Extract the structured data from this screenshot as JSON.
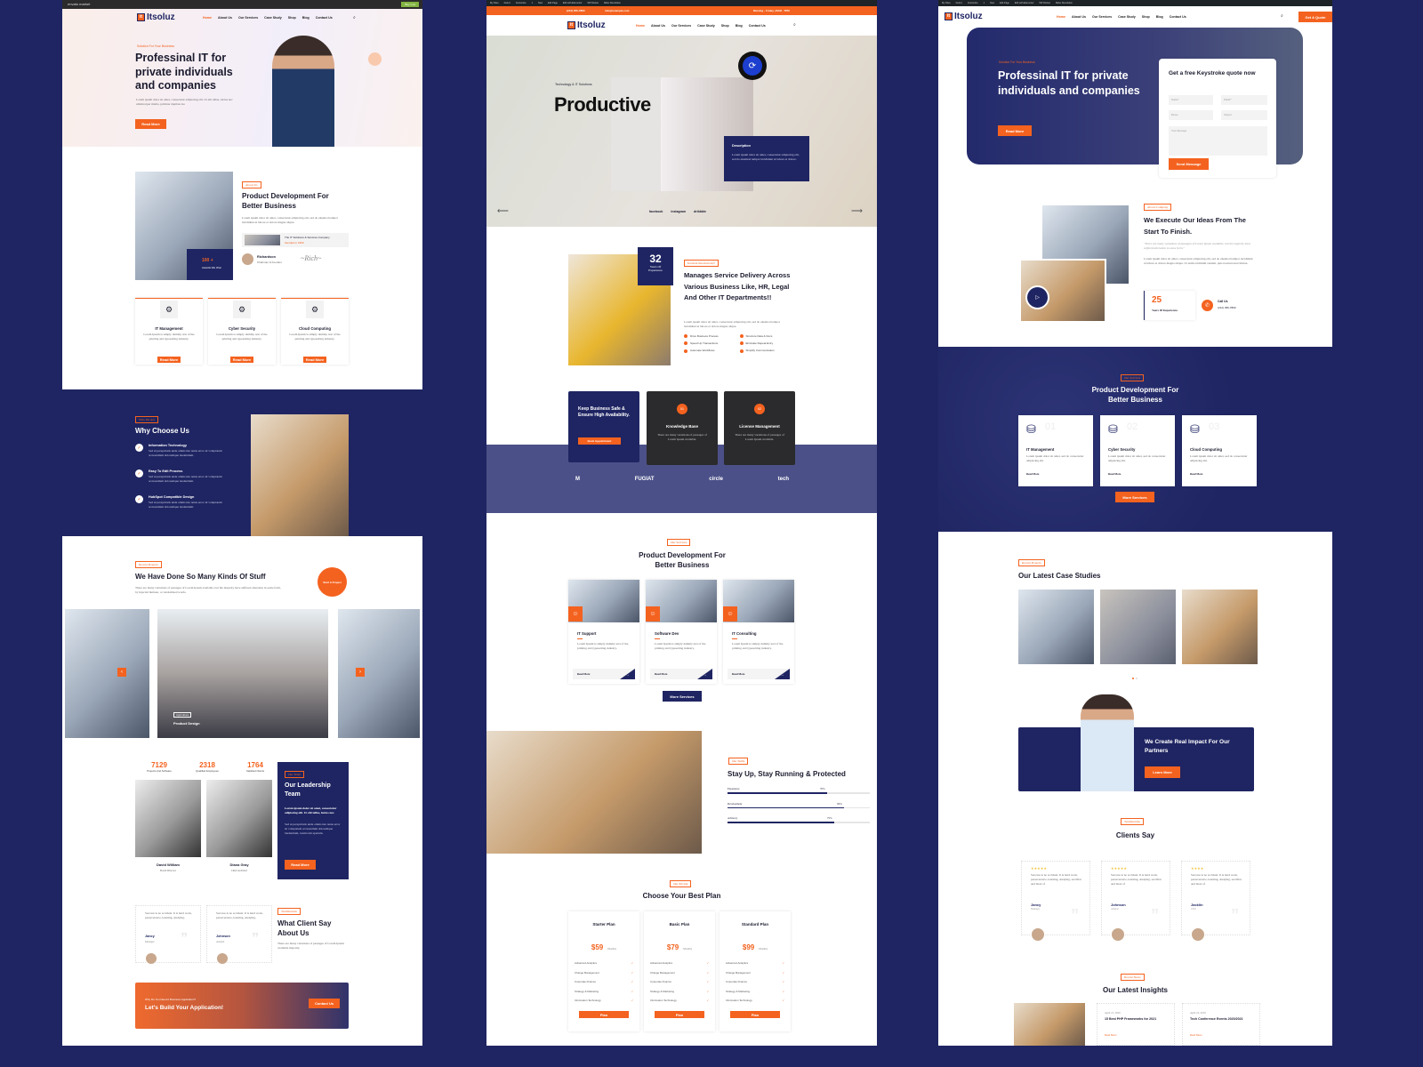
{
  "colors": {
    "navy": "#1f2562",
    "orange": "#f4621f"
  },
  "brand": "Itsoluz",
  "nav": [
    "Home",
    "About Us",
    "Our Services",
    "Case Study",
    "Shop",
    "Blog",
    "Contact Us"
  ],
  "admin_bar": [
    "My Sites",
    "Itsoluz",
    "Customize",
    "1",
    "New",
    "Edit Page",
    "Edit with Elementor",
    "WP Rocket",
    "Slider Revolution"
  ],
  "demo1": {
    "envato": "envato market",
    "buy": "Buy now",
    "hero": {
      "tagline": "Solution For Your Business",
      "title": "Professinal IT for private individuals and companies",
      "desc": "Lorem ipsum dolor sit amet, consectetur adipiscing elit. Ut elit tellus, luctus nec ullamcorper mattis, pulvinar dapibus leo",
      "button": "Read More"
    },
    "about": {
      "label": "About Us",
      "title": "Product Development For Better Business",
      "desc": "Lorem ipsum dolor sit amet, consectetur adipiscing elit, sed do eiusmod tempor incididunt ut labore et dolore magna aliqua.",
      "company": "The IT Solutions & Services Company",
      "founded": "founded in 1990",
      "badge_num": "100 +",
      "badge_text": "Awards We Won",
      "founder": "Richardson",
      "founder_role": "Chairman & Founder"
    },
    "services": [
      {
        "title": "IT Management",
        "desc": "Lorem Ipsum is simply dummy text of the printing and typesetting industry.",
        "button": "Read More"
      },
      {
        "title": "Cyber Security",
        "desc": "Lorem Ipsum is simply dummy text of the printing and typesetting industry.",
        "button": "Read More"
      },
      {
        "title": "Cloud Computing",
        "desc": "Lorem Ipsum is simply dummy text of the printing and typesetting industry.",
        "button": "Read More"
      }
    ],
    "why": {
      "label": "Who We Are",
      "title": "Why Choose Us",
      "items": [
        {
          "title": "Information Technology",
          "desc": "Sed ut perspiciatis unde omnis iste natus error sit voluptatem accusantium doloremque laudantium."
        },
        {
          "title": "Easy To Edit Process",
          "desc": "Sed ut perspiciatis unde omnis iste natus error sit voluptatem accusantium doloremque laudantium."
        },
        {
          "title": "HubSpot Compatible Design",
          "desc": "Sed ut perspiciatis unde omnis iste natus error sit voluptatem accusantium doloremque laudantium."
        }
      ]
    },
    "projects": {
      "label": "Recent Projects",
      "title": "We Have Done So Many Kinds Of Stuff",
      "desc": "There are many variations of passages of Lorem Ipsum available, but the majority have suffered alteration in some form, by injected humour, or randomised words.",
      "start": "Start A Project",
      "slide_tag": "Agriculture",
      "slide_title": "Product Design"
    },
    "stats": [
      {
        "num": "7129",
        "label": "Projects And Software"
      },
      {
        "num": "2318",
        "label": "Qualified Employees"
      },
      {
        "num": "1764",
        "label": "Satisfied Clients"
      }
    ],
    "team": [
      {
        "name": "David William",
        "role": "Board Director"
      },
      {
        "name": "Diana Gray",
        "role": "Chief Architect"
      }
    ],
    "leadership": {
      "label": "Our Team",
      "title": "Our Leadership Team",
      "lead": "Lorem ipsum dolor sit amet, consectetur adipiscing elit. Ut elit tellus, luctus nec.",
      "desc": "Sed ut perspiciatis unde omnis iste natus error sit voluptatem accusantium doloremque laudantium, totam rem aperiam.",
      "button": "Read More"
    },
    "testimonials": [
      {
        "text": "Success is no accident. It is hard work, perseverance, learning, studying,",
        "name": "Jancy",
        "role": "Manager"
      },
      {
        "text": "Success is no accident. It is hard work, perseverance, learning, studying,",
        "name": "Johnson",
        "role": "Analyst"
      }
    ],
    "testi_head": {
      "label": "Testimonials",
      "title": "What Client Say About Us",
      "desc": "There are many variations of passages of Lorem Ipsum available majority."
    },
    "cta": {
      "kicker": "Why Do You Need A Business Application?",
      "title": "Let's Build Your Application!",
      "button": "Contact Us"
    }
  },
  "demo2": {
    "topbar": {
      "phone": "(212) 256-7890",
      "email": "info@example.com",
      "hours": "Monday - Friday | 8AM - 7PM"
    },
    "hero": {
      "tag": "Technology & IT Solutions",
      "title": "Productive",
      "desc_title": "Description",
      "desc": "Lorem ipsum dolor sit amet, consectetur adipiscing elit, sed do eiusmod tempor incididunt ut labore et dolore.",
      "social": [
        "facebook",
        "instagram",
        "dribbble"
      ]
    },
    "about": {
      "years": "32",
      "years_label": "Years Of Experience",
      "label": "Incident Resolutions!!",
      "title": "Manages Service Delivery Across Various Business Like, HR, Legal And Other IT Departments!!",
      "desc": "Lorem ipsum dolor sit amet, consectetur adipiscing elit, sed do eiusmod tempor incididunt ut labore et dolore magna aliqua.",
      "checks": [
        "Drive Business Process",
        "Structure Data & Docs",
        "Speed Up Transactions",
        "Eliminate Repeat Entry",
        "Automate Workflows",
        "Simplify Communication"
      ]
    },
    "features": {
      "main_title": "Keep Business Safe & Ensure High Availability.",
      "main_button": "Book Appointment",
      "items": [
        {
          "num": "01",
          "title": "Knowledge Base",
          "desc": "There are many variations of passages of Lorem Ipsum available."
        },
        {
          "num": "02",
          "title": "License Management",
          "desc": "There are many variations of passages of Lorem Ipsum available."
        }
      ]
    },
    "logos": [
      "M",
      "FUGIAT",
      "circle",
      "tech"
    ],
    "services": {
      "label": "Our Services",
      "title": "Product Development For Better Business",
      "items": [
        {
          "title": "IT Support",
          "desc": "Lorem Ipsum is simply dummy text of the printing and typesetting industry.",
          "link": "Read More"
        },
        {
          "title": "Software Dev",
          "desc": "Lorem Ipsum is simply dummy text of the printing and typesetting industry.",
          "link": "Read More"
        },
        {
          "title": "IT Consulting",
          "desc": "Lorem Ipsum is simply dummy text of the printing and typesetting industry.",
          "link": "Read More"
        }
      ],
      "more": "More Services"
    },
    "skills": {
      "label": "Our Skills",
      "title": "Stay Up, Stay Running & Protected",
      "items": [
        {
          "name": "Experience",
          "value": 70,
          "text": "70%"
        },
        {
          "name": "Development",
          "value": 82,
          "text": "82%"
        },
        {
          "name": "Advisory",
          "value": 75,
          "text": "75%"
        }
      ]
    },
    "pricing": {
      "label": "Our Pricing",
      "title": "Choose Your Best Plan",
      "plans": [
        {
          "name": "Starter Plan",
          "price": "$59",
          "period": "/Monthly",
          "button": "Plan"
        },
        {
          "name": "Basic Plan",
          "price": "$79",
          "period": "/Monthly",
          "button": "Plan"
        },
        {
          "name": "Standard Plan",
          "price": "$99",
          "period": "/Monthly",
          "button": "Plan"
        }
      ],
      "features": [
        "Advanced Analytics",
        "Change Management",
        "Corporate Finance",
        "Strategy & Marketing",
        "Information Technology"
      ]
    }
  },
  "demo3": {
    "quote_button": "Get A Quote",
    "hero": {
      "tagline": "Solution For Your Business",
      "title": "Professinal IT for private individuals and companies",
      "button": "Read More"
    },
    "form": {
      "title": "Get a free Keystroke quote now",
      "name": "Name*",
      "email": "Email*",
      "phone": "Phone",
      "subject": "Subject",
      "message": "Your Message",
      "button": "Send Message"
    },
    "about": {
      "label": "About Company",
      "title": "We Execute Our Ideas From The Start To Finish.",
      "quote": "\"There are many variations of passages of Lorem Ipsum available, but the majority have suffered alteration in some form.\"",
      "desc": "Lorem ipsum dolor sit amet, consectetur adipiscing elit, sed do eiusmod tempor incididunt ut labore et dolore magna aliqua. Ut enim ad minim veniam, quis nostrud exercitation.",
      "years": "25",
      "years_label": "Years Of Experience",
      "call": "Call Us",
      "phone": "(212) 456-7890"
    },
    "services": {
      "label": "Our Services",
      "title": "Product Development For Better Business",
      "items": [
        {
          "num": "01",
          "title": "IT Management",
          "desc": "Lorem ipsum dolor sit amet, sed do consectetur adipiscing elit.",
          "link": "Read More"
        },
        {
          "num": "02",
          "title": "Cyber Security",
          "desc": "Lorem ipsum dolor sit amet, sed do consectetur adipiscing elit.",
          "link": "Read More"
        },
        {
          "num": "03",
          "title": "Cloud Computing",
          "desc": "Lorem ipsum dolor sit amet, sed do consectetur adipiscing elit.",
          "link": "Read More"
        }
      ],
      "more": "More Services"
    },
    "cases": {
      "label": "Recent Projects",
      "title": "Our Latest Case Studies"
    },
    "impact": {
      "title": "We Create Real Impact For Our Partners",
      "button": "Learn More"
    },
    "testimonials": {
      "label": "Testimonials",
      "title": "Clients Say",
      "items": [
        {
          "stars": "★★★★★",
          "text": "Success is no accident. It is hard work, perseverance, learning, studying, sacrifice and most of",
          "name": "Jancy",
          "role": "Manager"
        },
        {
          "stars": "★★★★★",
          "text": "Success is no accident. It is hard work, perseverance, learning, studying, sacrifice and most of",
          "name": "Johnson",
          "role": "Analyst"
        },
        {
          "stars": "★★★★",
          "text": "Success is no accident. It is hard work, perseverance, learning, studying, sacrifice and most of",
          "name": "Jacklin",
          "role": "CEO"
        }
      ]
    },
    "news": {
      "label": "Recent News",
      "title": "Our Latest Insights",
      "items": [
        {
          "date": "April 21, 2020",
          "title": "15 Best PHP Frameworks for 2021",
          "link": "Read More"
        },
        {
          "date": "April 19, 2019",
          "title": "Tech Conference Events 2020/2021",
          "link": "Read More"
        }
      ]
    }
  }
}
